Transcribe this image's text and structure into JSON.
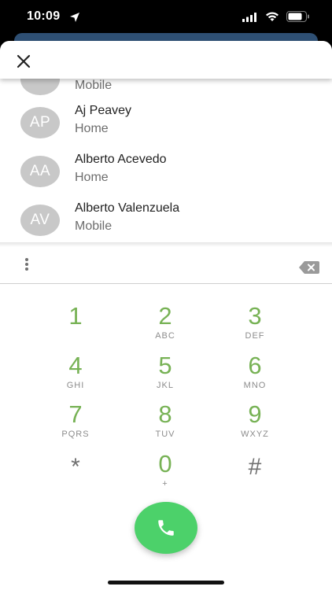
{
  "status_bar": {
    "time": "10:09",
    "icons": [
      "location-arrow-icon",
      "cellular-signal-icon",
      "wifi-icon",
      "battery-icon"
    ]
  },
  "header": {
    "close_icon": "close-icon"
  },
  "contacts": [
    {
      "initials": "",
      "name": "",
      "type": "Mobile"
    },
    {
      "initials": "AP",
      "name": "Aj Peavey",
      "type": "Home"
    },
    {
      "initials": "AA",
      "name": "Alberto Acevedo",
      "type": "Home"
    },
    {
      "initials": "AV",
      "name": "Alberto Valenzuela",
      "type": "Mobile"
    }
  ],
  "dialer": {
    "input_value": "",
    "keys": [
      {
        "digit": "1",
        "letters": ""
      },
      {
        "digit": "2",
        "letters": "ABC"
      },
      {
        "digit": "3",
        "letters": "DEF"
      },
      {
        "digit": "4",
        "letters": "GHI"
      },
      {
        "digit": "5",
        "letters": "JKL"
      },
      {
        "digit": "6",
        "letters": "MNO"
      },
      {
        "digit": "7",
        "letters": "PQRS"
      },
      {
        "digit": "8",
        "letters": "TUV"
      },
      {
        "digit": "9",
        "letters": "WXYZ"
      },
      {
        "digit": "*",
        "letters": ""
      },
      {
        "digit": "0",
        "letters": "+"
      },
      {
        "digit": "#",
        "letters": ""
      }
    ]
  },
  "colors": {
    "digit_green": "#77b255",
    "call_green": "#4cd16a",
    "avatar_gray": "#c8c8c8"
  }
}
